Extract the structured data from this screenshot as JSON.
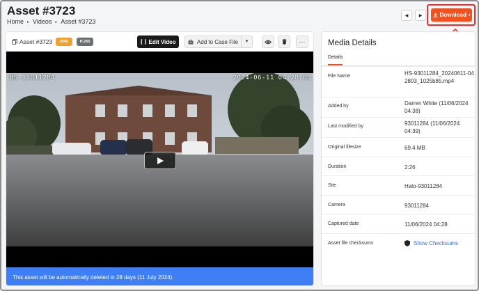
{
  "page": {
    "title": "Asset #3723",
    "breadcrumb": [
      "Home",
      "Videos",
      "Asset #3723"
    ],
    "breadcrumb_separator": "▸"
  },
  "header": {
    "prev_icon": "chevron-left-icon",
    "next_icon": "chevron-right-icon",
    "download_label": "Download",
    "download_color": "#f0531f",
    "highlight_color": "#e63030"
  },
  "toolbar": {
    "asset_label": "Asset #3723",
    "badge_primary": "000€",
    "badge_codec": "H.265",
    "edit_video_label": "Edit Video",
    "add_to_case_label": "Add to Case File"
  },
  "video": {
    "camera_id_overlay": "HS-93011284",
    "timestamp_overlay": "2024-06-11 04:28:03"
  },
  "notice": {
    "text": "This asset will be automatically deleted in 28 days (11 July 2024).",
    "color": "#3f7ff5"
  },
  "details": {
    "title": "Media Details",
    "tab_label": "Details",
    "rows": [
      {
        "label": "File Name",
        "value": "HS-93011284_20240611-042803_1025b85.mp4"
      },
      {
        "label": "Added by",
        "value": "Darren White (11/06/2024 04:38)"
      },
      {
        "label": "Last modified by",
        "value": "93011284 (11/06/2024 04:39)"
      },
      {
        "label": "Original filesize",
        "value": "69.4 MB"
      },
      {
        "label": "Duration",
        "value": "2:26"
      },
      {
        "label": "Site",
        "value": "Halo-93011284"
      },
      {
        "label": "Camera",
        "value": "93011284"
      },
      {
        "label": "Captured date",
        "value": "11/06/2024 04:28"
      },
      {
        "label": "Asset file checksums",
        "value": "Show Checksums"
      }
    ]
  }
}
